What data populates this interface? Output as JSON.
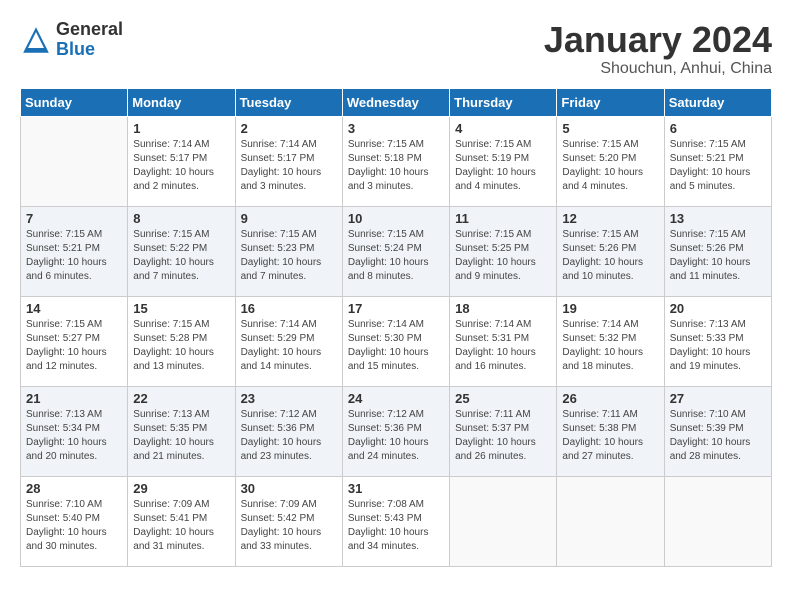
{
  "header": {
    "logo_general": "General",
    "logo_blue": "Blue",
    "title": "January 2024",
    "subtitle": "Shouchun, Anhui, China"
  },
  "weekdays": [
    "Sunday",
    "Monday",
    "Tuesday",
    "Wednesday",
    "Thursday",
    "Friday",
    "Saturday"
  ],
  "weeks": [
    [
      {
        "day": "",
        "info": ""
      },
      {
        "day": "1",
        "info": "Sunrise: 7:14 AM\nSunset: 5:17 PM\nDaylight: 10 hours\nand 2 minutes."
      },
      {
        "day": "2",
        "info": "Sunrise: 7:14 AM\nSunset: 5:17 PM\nDaylight: 10 hours\nand 3 minutes."
      },
      {
        "day": "3",
        "info": "Sunrise: 7:15 AM\nSunset: 5:18 PM\nDaylight: 10 hours\nand 3 minutes."
      },
      {
        "day": "4",
        "info": "Sunrise: 7:15 AM\nSunset: 5:19 PM\nDaylight: 10 hours\nand 4 minutes."
      },
      {
        "day": "5",
        "info": "Sunrise: 7:15 AM\nSunset: 5:20 PM\nDaylight: 10 hours\nand 4 minutes."
      },
      {
        "day": "6",
        "info": "Sunrise: 7:15 AM\nSunset: 5:21 PM\nDaylight: 10 hours\nand 5 minutes."
      }
    ],
    [
      {
        "day": "7",
        "info": "Sunrise: 7:15 AM\nSunset: 5:21 PM\nDaylight: 10 hours\nand 6 minutes."
      },
      {
        "day": "8",
        "info": "Sunrise: 7:15 AM\nSunset: 5:22 PM\nDaylight: 10 hours\nand 7 minutes."
      },
      {
        "day": "9",
        "info": "Sunrise: 7:15 AM\nSunset: 5:23 PM\nDaylight: 10 hours\nand 7 minutes."
      },
      {
        "day": "10",
        "info": "Sunrise: 7:15 AM\nSunset: 5:24 PM\nDaylight: 10 hours\nand 8 minutes."
      },
      {
        "day": "11",
        "info": "Sunrise: 7:15 AM\nSunset: 5:25 PM\nDaylight: 10 hours\nand 9 minutes."
      },
      {
        "day": "12",
        "info": "Sunrise: 7:15 AM\nSunset: 5:26 PM\nDaylight: 10 hours\nand 10 minutes."
      },
      {
        "day": "13",
        "info": "Sunrise: 7:15 AM\nSunset: 5:26 PM\nDaylight: 10 hours\nand 11 minutes."
      }
    ],
    [
      {
        "day": "14",
        "info": "Sunrise: 7:15 AM\nSunset: 5:27 PM\nDaylight: 10 hours\nand 12 minutes."
      },
      {
        "day": "15",
        "info": "Sunrise: 7:15 AM\nSunset: 5:28 PM\nDaylight: 10 hours\nand 13 minutes."
      },
      {
        "day": "16",
        "info": "Sunrise: 7:14 AM\nSunset: 5:29 PM\nDaylight: 10 hours\nand 14 minutes."
      },
      {
        "day": "17",
        "info": "Sunrise: 7:14 AM\nSunset: 5:30 PM\nDaylight: 10 hours\nand 15 minutes."
      },
      {
        "day": "18",
        "info": "Sunrise: 7:14 AM\nSunset: 5:31 PM\nDaylight: 10 hours\nand 16 minutes."
      },
      {
        "day": "19",
        "info": "Sunrise: 7:14 AM\nSunset: 5:32 PM\nDaylight: 10 hours\nand 18 minutes."
      },
      {
        "day": "20",
        "info": "Sunrise: 7:13 AM\nSunset: 5:33 PM\nDaylight: 10 hours\nand 19 minutes."
      }
    ],
    [
      {
        "day": "21",
        "info": "Sunrise: 7:13 AM\nSunset: 5:34 PM\nDaylight: 10 hours\nand 20 minutes."
      },
      {
        "day": "22",
        "info": "Sunrise: 7:13 AM\nSunset: 5:35 PM\nDaylight: 10 hours\nand 21 minutes."
      },
      {
        "day": "23",
        "info": "Sunrise: 7:12 AM\nSunset: 5:36 PM\nDaylight: 10 hours\nand 23 minutes."
      },
      {
        "day": "24",
        "info": "Sunrise: 7:12 AM\nSunset: 5:36 PM\nDaylight: 10 hours\nand 24 minutes."
      },
      {
        "day": "25",
        "info": "Sunrise: 7:11 AM\nSunset: 5:37 PM\nDaylight: 10 hours\nand 26 minutes."
      },
      {
        "day": "26",
        "info": "Sunrise: 7:11 AM\nSunset: 5:38 PM\nDaylight: 10 hours\nand 27 minutes."
      },
      {
        "day": "27",
        "info": "Sunrise: 7:10 AM\nSunset: 5:39 PM\nDaylight: 10 hours\nand 28 minutes."
      }
    ],
    [
      {
        "day": "28",
        "info": "Sunrise: 7:10 AM\nSunset: 5:40 PM\nDaylight: 10 hours\nand 30 minutes."
      },
      {
        "day": "29",
        "info": "Sunrise: 7:09 AM\nSunset: 5:41 PM\nDaylight: 10 hours\nand 31 minutes."
      },
      {
        "day": "30",
        "info": "Sunrise: 7:09 AM\nSunset: 5:42 PM\nDaylight: 10 hours\nand 33 minutes."
      },
      {
        "day": "31",
        "info": "Sunrise: 7:08 AM\nSunset: 5:43 PM\nDaylight: 10 hours\nand 34 minutes."
      },
      {
        "day": "",
        "info": ""
      },
      {
        "day": "",
        "info": ""
      },
      {
        "day": "",
        "info": ""
      }
    ]
  ]
}
